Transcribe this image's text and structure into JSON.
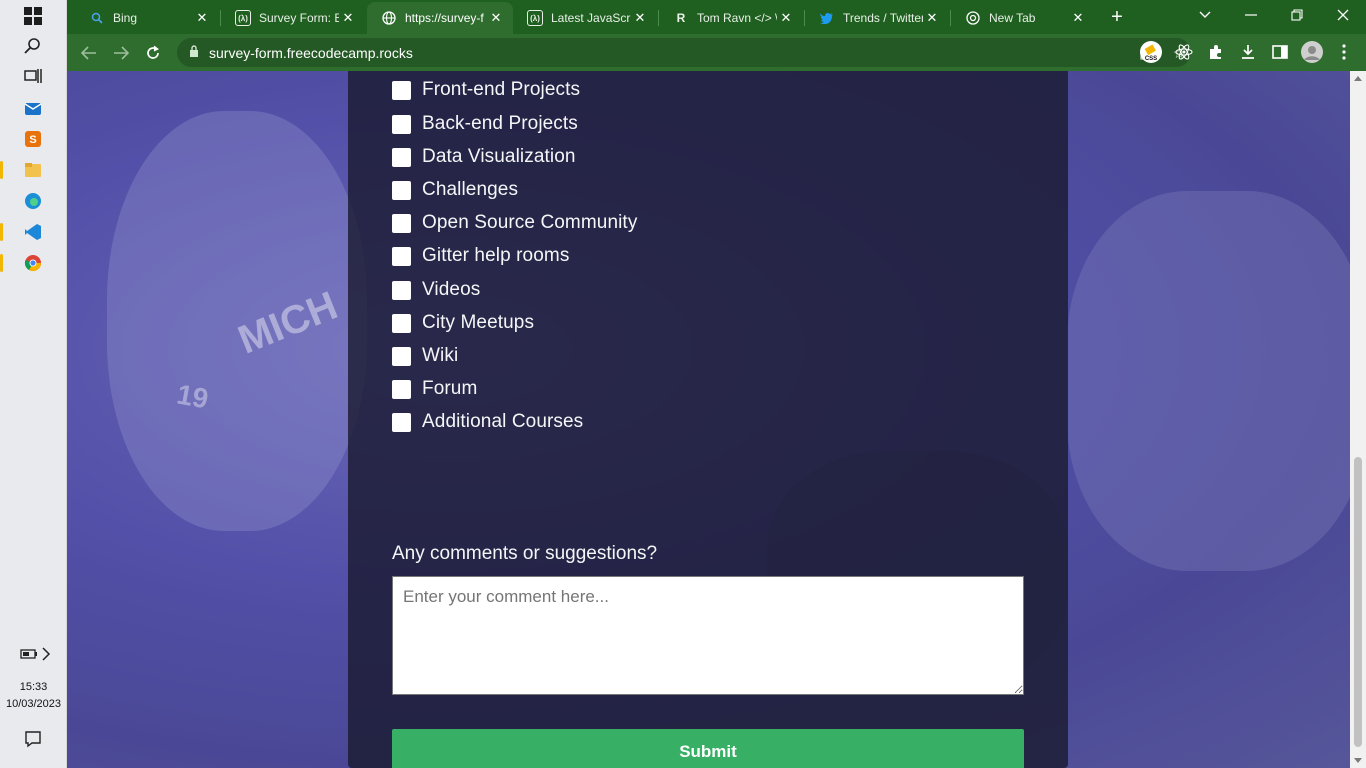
{
  "taskbar": {
    "icons": [
      {
        "name": "windows-start-icon",
        "glyph": "⊞"
      },
      {
        "name": "search-icon",
        "glyph": "⚲"
      },
      {
        "name": "task-view-icon",
        "glyph": "▤"
      },
      {
        "name": "mail-icon",
        "glyph": "✉"
      },
      {
        "name": "sublime-text-icon",
        "glyph": "S"
      },
      {
        "name": "file-explorer-icon",
        "glyph": "▰"
      },
      {
        "name": "edge-icon",
        "glyph": "◍"
      },
      {
        "name": "vscode-icon",
        "glyph": "⟩"
      },
      {
        "name": "chrome-icon",
        "glyph": "◉"
      }
    ],
    "time": "15:33",
    "date": "10/03/2023"
  },
  "tabs": [
    {
      "title": "Bing",
      "favicon": "search-icon"
    },
    {
      "title": "Survey Form: Bu",
      "favicon": "freecodecamp-icon"
    },
    {
      "title": "https://survey-f",
      "favicon": "globe-icon",
      "active": true
    },
    {
      "title": "Latest JavaScrip",
      "favicon": "freecodecamp-icon"
    },
    {
      "title": "Tom Ravn </> \\",
      "favicon": "r-logo-icon"
    },
    {
      "title": "Trends / Twitter",
      "favicon": "twitter-icon"
    },
    {
      "title": "New Tab",
      "favicon": "chrome-icon"
    }
  ],
  "omnibox": {
    "url": "survey-form.freecodecamp.rocks"
  },
  "form": {
    "checkboxes": [
      "Front-end Projects",
      "Back-end Projects",
      "Data Visualization",
      "Challenges",
      "Open Source Community",
      "Gitter help rooms",
      "Videos",
      "City Meetups",
      "Wiki",
      "Forum",
      "Additional Courses"
    ],
    "comments_label": "Any comments or suggestions?",
    "comments_placeholder": "Enter your comment here...",
    "submit_label": "Submit"
  },
  "colors": {
    "tabstrip": "#1f5f1f",
    "toolbar": "#2f6d2f",
    "submit": "#37af65",
    "form_bg": "#1b1b32"
  }
}
